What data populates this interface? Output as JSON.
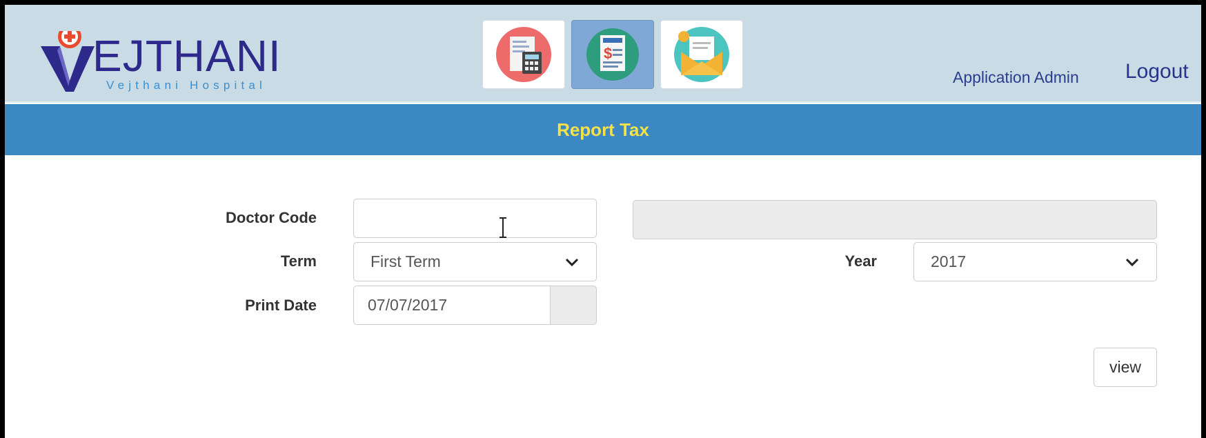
{
  "header": {
    "logo_text": "EJTHANI",
    "logo_subtitle": "Vejthani Hospital",
    "nav_icons": [
      "tax-calculator-icon",
      "tax-document-icon",
      "email-envelope-icon"
    ],
    "active_nav_index": 1,
    "user_name": "Application Admin",
    "logout_label": "Logout"
  },
  "page": {
    "title": "Report Tax"
  },
  "form": {
    "doctor_code_label": "Doctor Code",
    "doctor_code_value": "",
    "doctor_name_value": "",
    "term_label": "Term",
    "term_value": "First Term",
    "year_label": "Year",
    "year_value": "2017",
    "print_date_label": "Print Date",
    "print_date_value": "07/07/2017",
    "view_button_label": "view"
  },
  "colors": {
    "header_bg": "#c9dbe5",
    "title_bar_bg": "#3b88c3",
    "title_text": "#f5e14a",
    "brand_navy": "#2e2a8c",
    "active_nav_bg": "#7fa8d6"
  }
}
